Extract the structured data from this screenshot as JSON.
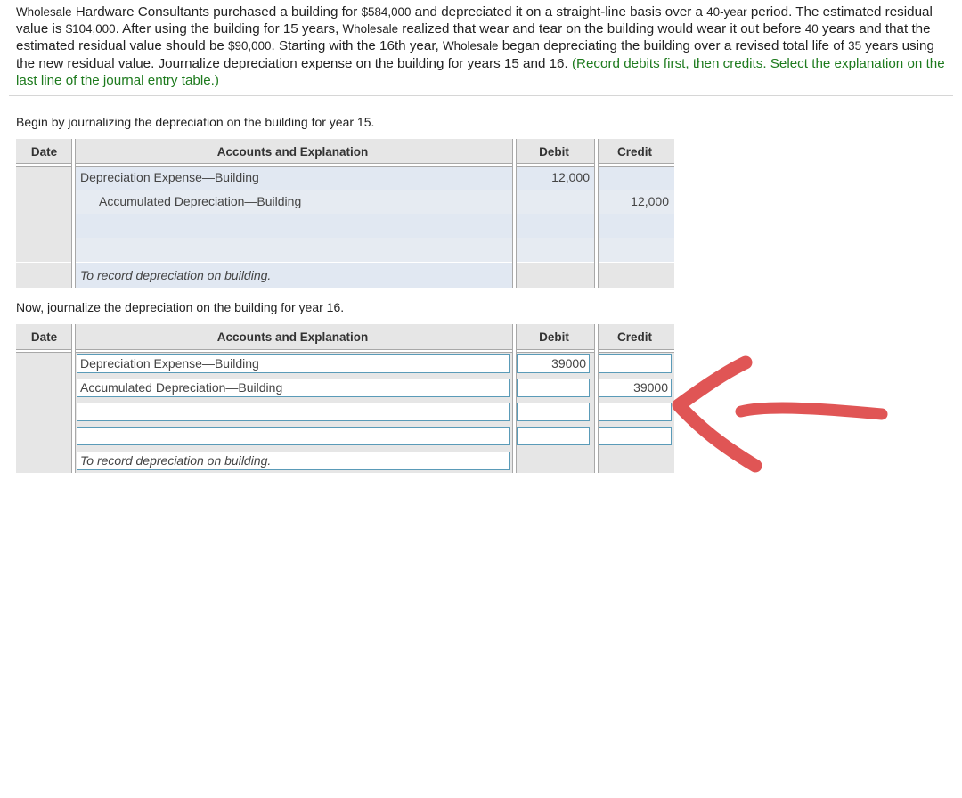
{
  "problem": {
    "seg1": "Wholesale",
    "seg2": " Hardware Consultants purchased a building for ",
    "seg3": "$584,000",
    "seg4": " and depreciated it on a straight-line basis over a ",
    "seg5": "40-year",
    "seg6": " period. The estimated residual value is ",
    "seg7": "$104,000",
    "seg8": ". After using the building for 15 years, ",
    "seg9": "Wholesale",
    "seg10": " realized that wear and tear on the building would wear it out before ",
    "seg11": "40",
    "seg12": " years and that the estimated residual value should be ",
    "seg13": "$90,000",
    "seg14": ". Starting with the 16th year, ",
    "seg15": "Wholesale",
    "seg16": " began depreciating the building over a revised total life of ",
    "seg17": "35",
    "seg18": " years using the new residual value. Journalize depreciation expense on the building for years 15 and 16. ",
    "instruction": "(Record debits first, then credits. Select the explanation on the last line of the journal entry table.)"
  },
  "entry15": {
    "prompt": "Begin by journalizing the depreciation on the building for year 15.",
    "headers": {
      "date": "Date",
      "accounts": "Accounts and Explanation",
      "debit": "Debit",
      "credit": "Credit"
    },
    "rows": [
      {
        "account": "Depreciation Expense—Building",
        "debit": "12,000",
        "credit": ""
      },
      {
        "account": "Accumulated Depreciation—Building",
        "debit": "",
        "credit": "12,000"
      }
    ],
    "explanation": "To record depreciation on building."
  },
  "entry16": {
    "prompt": "Now, journalize the depreciation on the building for year 16.",
    "headers": {
      "date": "Date",
      "accounts": "Accounts and Explanation",
      "debit": "Debit",
      "credit": "Credit"
    },
    "rows": [
      {
        "account": "Depreciation Expense—Building",
        "debit": "39000",
        "credit": ""
      },
      {
        "account": "Accumulated Depreciation—Building",
        "debit": "",
        "credit": "39000"
      },
      {
        "account": "",
        "debit": "",
        "credit": ""
      },
      {
        "account": "",
        "debit": "",
        "credit": ""
      }
    ],
    "explanation": "To record depreciation on building."
  },
  "annotation": {
    "icon": "red-arrow-icon",
    "color": "#e05555"
  }
}
